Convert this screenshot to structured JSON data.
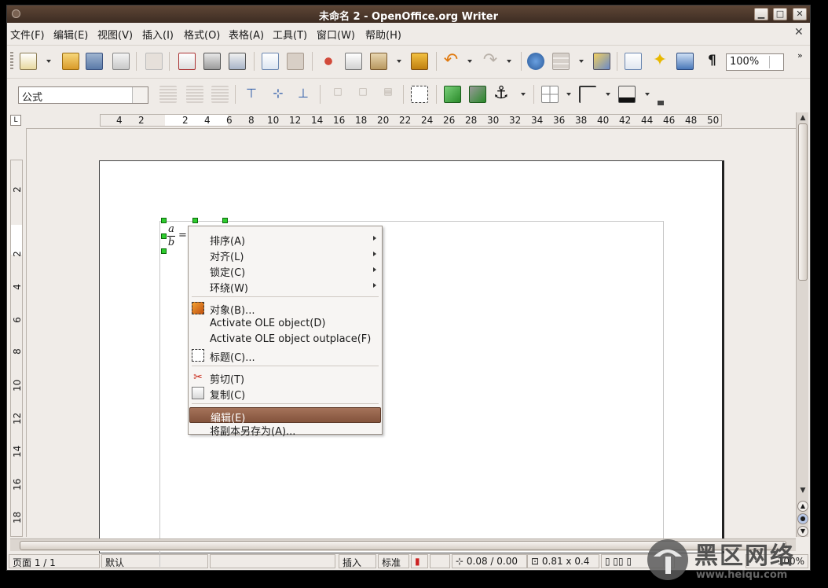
{
  "window": {
    "title": "未命名 2 - OpenOffice.org Writer"
  },
  "menubar": {
    "items": [
      "文件(F)",
      "编辑(E)",
      "视图(V)",
      "插入(I)",
      "格式(O)",
      "表格(A)",
      "工具(T)",
      "窗口(W)",
      "帮助(H)"
    ],
    "close_glyph": "✕"
  },
  "toolbar": {
    "zoom": "100%",
    "pilcrow": "¶"
  },
  "formatting": {
    "style": "公式"
  },
  "hruler": {
    "labels": [
      "4",
      "2",
      "2",
      "4",
      "6",
      "8",
      "10",
      "12",
      "14",
      "16",
      "18",
      "20",
      "22",
      "24",
      "26",
      "28",
      "30",
      "32",
      "34",
      "36",
      "38",
      "40",
      "42",
      "44",
      "46",
      "48",
      "50"
    ]
  },
  "vruler": {
    "labels": [
      "2",
      "2",
      "4",
      "6",
      "8",
      "10",
      "12",
      "14",
      "16",
      "18"
    ]
  },
  "formula": {
    "numerator": "a",
    "denominator": "b",
    "operator": "="
  },
  "context_menu": {
    "items": [
      {
        "label": "排序(A)",
        "submenu": true
      },
      {
        "label": "对齐(L)",
        "submenu": true
      },
      {
        "label": "锁定(C)",
        "submenu": true
      },
      {
        "label": "环绕(W)",
        "submenu": true
      },
      {
        "label": "对象(B)...",
        "icon": "object-icon"
      },
      {
        "label": "Activate OLE object(D)"
      },
      {
        "label": "Activate OLE object outplace(F)"
      },
      {
        "label": "标题(C)...",
        "icon": "caption-icon"
      },
      {
        "label": "剪切(T)",
        "icon": "scissors-icon"
      },
      {
        "label": "复制(C)",
        "icon": "copy-icon"
      },
      {
        "label": "编辑(E)",
        "highlighted": true
      },
      {
        "label": "将副本另存为(A)..."
      }
    ]
  },
  "statusbar": {
    "page": "页面 1 / 1",
    "style": "默认",
    "insert_mode": "插入",
    "selection_mode": "标准",
    "position": "0.08 / 0.00",
    "size": "0.81 x 0.4",
    "zoom": "100%"
  },
  "watermark": {
    "main": "黑区网络",
    "sub": "www.heiqu.com"
  },
  "colors": {
    "titlebar": "#4a362a",
    "highlight": "#94604a",
    "handle": "#2ecc2e"
  }
}
